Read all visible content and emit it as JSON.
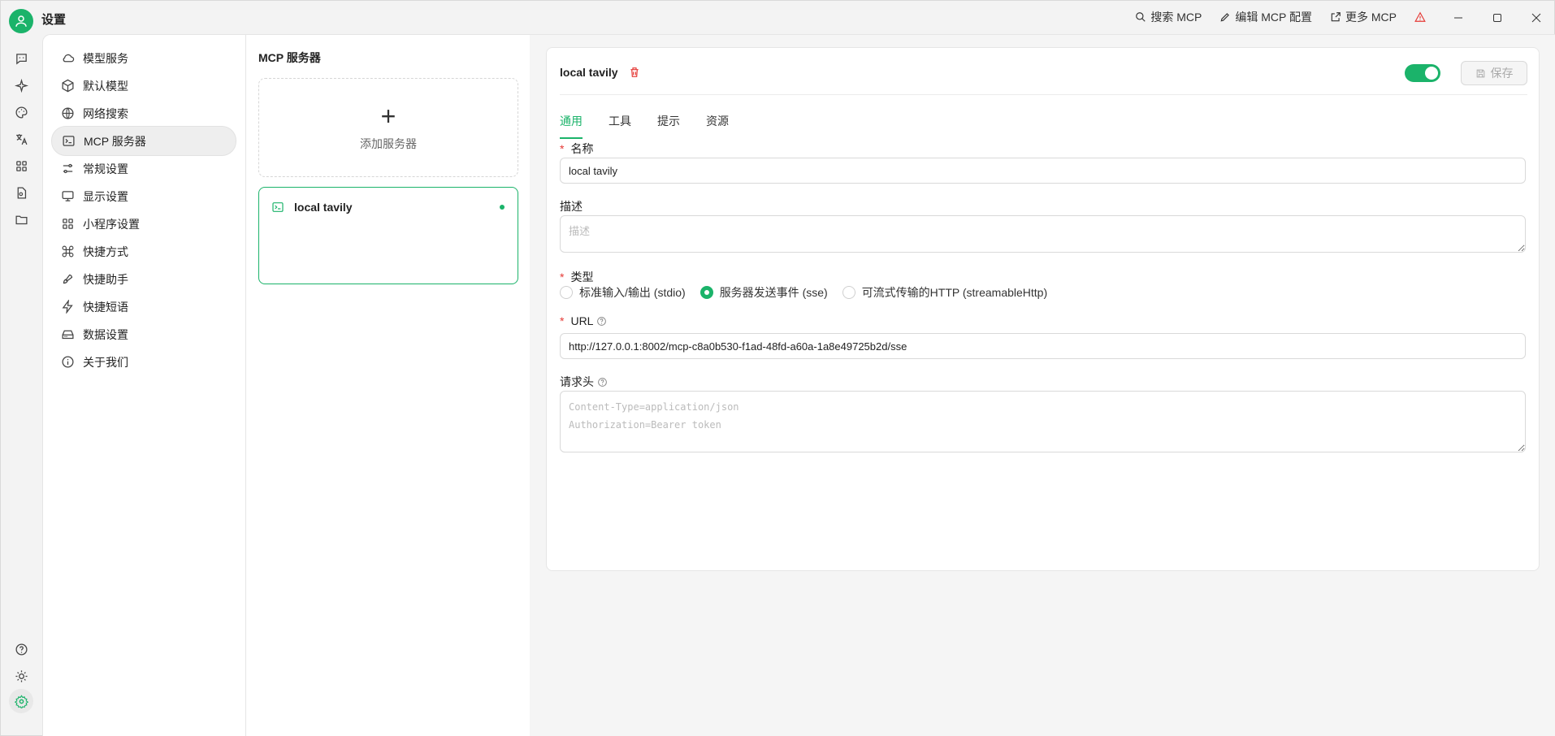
{
  "app": {
    "title": "设置"
  },
  "top_actions": {
    "search_mcp": "搜索 MCP",
    "edit_mcp_config": "编辑 MCP 配置",
    "more_mcp": "更多 MCP"
  },
  "settings_nav": {
    "items": [
      {
        "label": "模型服务",
        "icon": "cloud-icon"
      },
      {
        "label": "默认模型",
        "icon": "cube-icon"
      },
      {
        "label": "网络搜索",
        "icon": "globe-icon"
      },
      {
        "label": "MCP 服务器",
        "icon": "terminal-icon"
      },
      {
        "label": "常规设置",
        "icon": "sliders-icon"
      },
      {
        "label": "显示设置",
        "icon": "monitor-icon"
      },
      {
        "label": "小程序设置",
        "icon": "grid-icon"
      },
      {
        "label": "快捷方式",
        "icon": "command-icon"
      },
      {
        "label": "快捷助手",
        "icon": "rocket-icon"
      },
      {
        "label": "快捷短语",
        "icon": "zap-icon"
      },
      {
        "label": "数据设置",
        "icon": "hard-drive-icon"
      },
      {
        "label": "关于我们",
        "icon": "info-icon"
      }
    ],
    "active_index": 3
  },
  "server_list": {
    "title": "MCP 服务器",
    "add_label": "添加服务器",
    "servers": [
      {
        "name": "local tavily",
        "status": "active"
      }
    ]
  },
  "detail": {
    "title": "local tavily",
    "enabled": true,
    "save_label": "保存",
    "tabs": [
      "通用",
      "工具",
      "提示",
      "资源"
    ],
    "active_tab": 0,
    "name_label": "名称",
    "name_value": "local tavily",
    "description_label": "描述",
    "description_placeholder": "描述",
    "type_label": "类型",
    "type_options": [
      "标准输入/输出 (stdio)",
      "服务器发送事件 (sse)",
      "可流式传输的HTTP (streamableHttp)"
    ],
    "type_selected": 1,
    "url_label": "URL",
    "url_value": "http://127.0.0.1:8002/mcp-c8a0b530-f1ad-48fd-a60a-1a8e49725b2d/sse",
    "headers_label": "请求头",
    "headers_placeholder": "Content-Type=application/json\nAuthorization=Bearer token"
  },
  "colors": {
    "accent": "#1bb36a",
    "danger": "#e53935"
  }
}
